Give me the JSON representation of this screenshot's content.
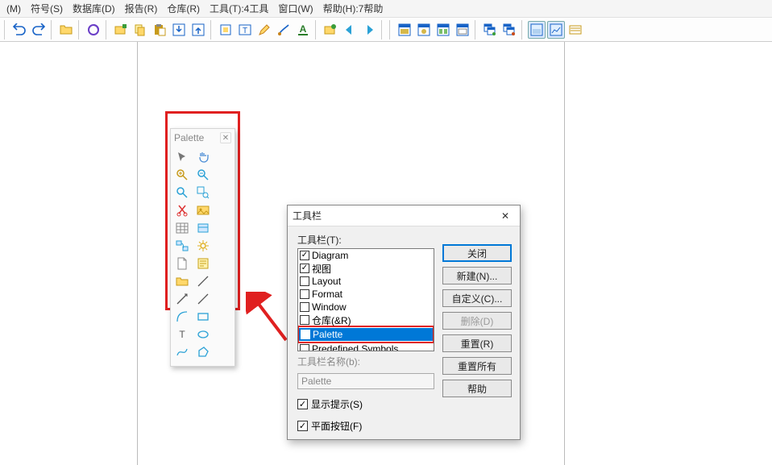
{
  "menu": {
    "items": [
      "(M)",
      "符号(S)",
      "数据库(D)",
      "报告(R)",
      "仓库(R)",
      "工具(T):4工具",
      "窗口(W)",
      "帮助(H):7帮助"
    ]
  },
  "palette": {
    "title": "Palette"
  },
  "dialog": {
    "title": "工具栏",
    "list_label": "工具栏(T):",
    "items": [
      {
        "label": "Diagram",
        "checked": true,
        "selected": false
      },
      {
        "label": "视图",
        "checked": true,
        "selected": false
      },
      {
        "label": "Layout",
        "checked": false,
        "selected": false
      },
      {
        "label": "Format",
        "checked": false,
        "selected": false
      },
      {
        "label": "Window",
        "checked": false,
        "selected": false
      },
      {
        "label": "仓库(&R)",
        "checked": false,
        "selected": false
      },
      {
        "label": "Palette",
        "checked": true,
        "selected": true
      },
      {
        "label": "Predefined Symbols",
        "checked": false,
        "selected": false
      }
    ],
    "name_label": "工具栏名称(b):",
    "name_value": "Palette",
    "show_tips": "显示提示(S)",
    "flat_buttons": "平面按钮(F)",
    "buttons": {
      "close": "关闭",
      "new": "新建(N)...",
      "customize": "自定义(C)...",
      "delete": "删除(D)",
      "reset": "重置(R)",
      "reset_all": "重置所有",
      "help": "帮助"
    }
  }
}
